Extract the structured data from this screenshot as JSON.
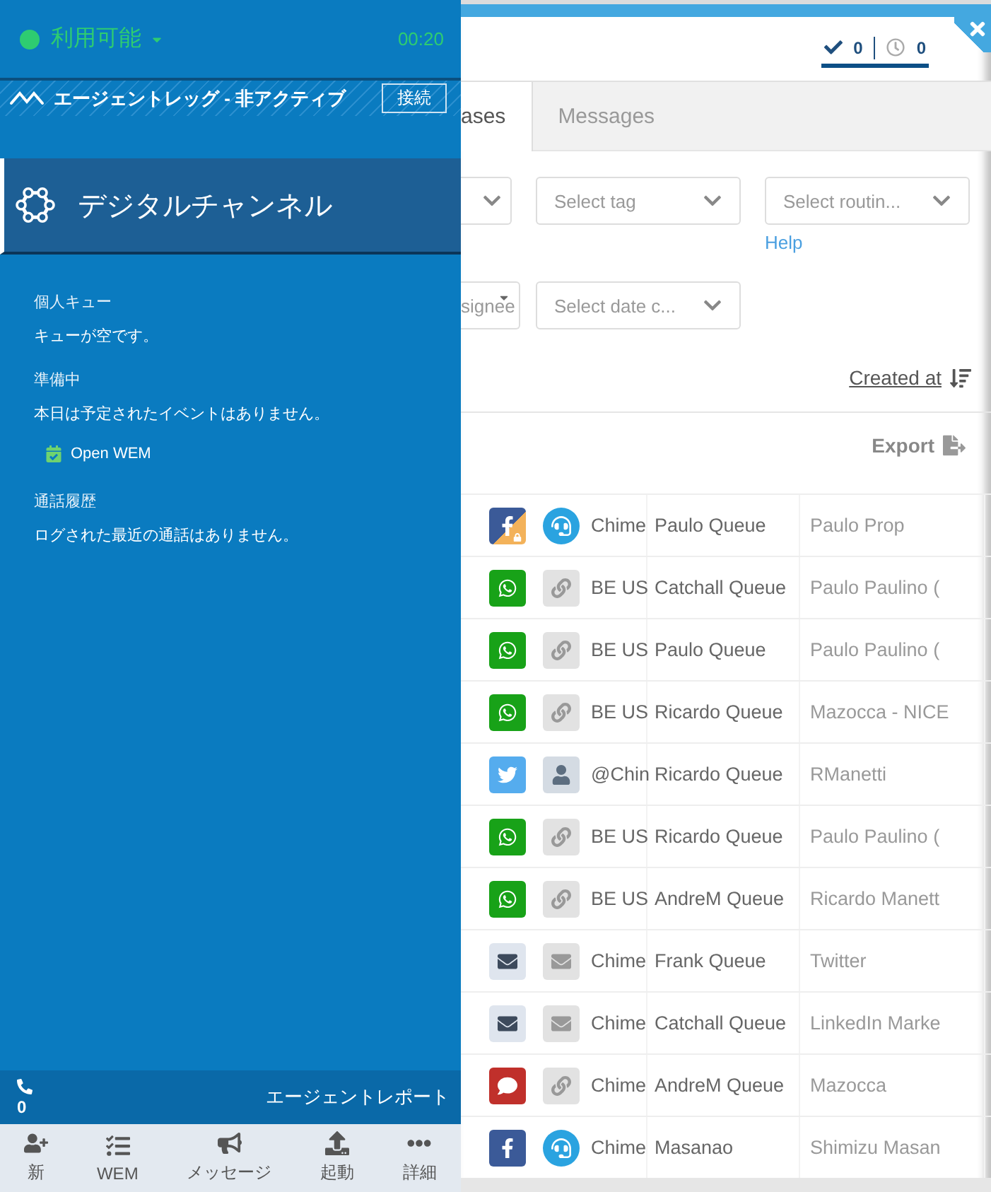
{
  "status": {
    "label": "利用可能",
    "time": "00:20"
  },
  "agent_leg": {
    "label": "エージェントレッグ - 非アクティブ",
    "button": "接続"
  },
  "channel": {
    "label": "デジタルチャンネル"
  },
  "sections": [
    {
      "heading": "個人キュー",
      "text": "キューが空です。"
    },
    {
      "heading": "準備中",
      "text": "本日は予定されたイベントはありません。",
      "link": "Open WEM"
    },
    {
      "heading": "通話履歴",
      "text": "ログされた最近の通話はありません。"
    }
  ],
  "call_bar": {
    "count": "0",
    "report": "エージェントレポート"
  },
  "nav": [
    {
      "kind": "new",
      "label": "新"
    },
    {
      "kind": "wem",
      "label": "WEM"
    },
    {
      "kind": "message",
      "label": "メッセージ"
    },
    {
      "kind": "launch",
      "label": "起動"
    },
    {
      "kind": "more",
      "label": "詳細"
    }
  ],
  "counters": [
    {
      "kind": "done",
      "value": "0"
    },
    {
      "kind": "pending",
      "value": "0"
    }
  ],
  "tabs": [
    {
      "label": "ases",
      "selected": true
    },
    {
      "label": "Messages",
      "selected": false
    }
  ],
  "filters": [
    [
      {
        "kind": "cut"
      },
      {
        "kind": "select",
        "placeholder": "Select tag"
      },
      {
        "kind": "select",
        "placeholder": "Select routin...",
        "help": "Help"
      }
    ],
    [
      {
        "kind": "cut",
        "placeholder": "signee"
      },
      {
        "kind": "select",
        "placeholder": "Select date c..."
      }
    ]
  ],
  "sort": {
    "label": "Created at"
  },
  "export": {
    "label": "Export"
  },
  "rows": [
    {
      "icons": [
        {
          "kind": "facebook-locked"
        },
        {
          "kind": "agent"
        }
      ],
      "source": "Chime",
      "queue": "Paulo Queue",
      "customer": "Paulo Prop"
    },
    {
      "icons": [
        {
          "kind": "whatsapp"
        },
        {
          "kind": "link"
        }
      ],
      "source": "BE US",
      "queue": "Catchall Queue",
      "customer": "Paulo Paulino ("
    },
    {
      "icons": [
        {
          "kind": "whatsapp"
        },
        {
          "kind": "link"
        }
      ],
      "source": "BE US",
      "queue": "Paulo Queue",
      "customer": "Paulo Paulino ("
    },
    {
      "icons": [
        {
          "kind": "whatsapp"
        },
        {
          "kind": "link"
        }
      ],
      "source": "BE US",
      "queue": "Ricardo Queue",
      "customer": "Mazocca - NICE"
    },
    {
      "icons": [
        {
          "kind": "twitter"
        },
        {
          "kind": "person"
        }
      ],
      "source": "@Chin",
      "queue": "Ricardo Queue",
      "customer": "RManetti"
    },
    {
      "icons": [
        {
          "kind": "whatsapp"
        },
        {
          "kind": "link"
        }
      ],
      "source": "BE US",
      "queue": "Ricardo Queue",
      "customer": "Paulo Paulino ("
    },
    {
      "icons": [
        {
          "kind": "whatsapp"
        },
        {
          "kind": "link"
        }
      ],
      "source": "BE US",
      "queue": "AndreM Queue",
      "customer": "Ricardo Manett"
    },
    {
      "icons": [
        {
          "kind": "email"
        },
        {
          "kind": "mail"
        }
      ],
      "source": "Chime",
      "queue": "Frank Queue",
      "customer": "Twitter"
    },
    {
      "icons": [
        {
          "kind": "email"
        },
        {
          "kind": "mail"
        }
      ],
      "source": "Chime",
      "queue": "Catchall Queue",
      "customer": "LinkedIn Marke"
    },
    {
      "icons": [
        {
          "kind": "chat"
        },
        {
          "kind": "link"
        }
      ],
      "source": "Chime",
      "queue": "AndreM Queue",
      "customer": "Mazocca"
    },
    {
      "icons": [
        {
          "kind": "facebook"
        },
        {
          "kind": "agent"
        }
      ],
      "source": "Chime",
      "queue": "Masanao",
      "customer": "Shimizu Masan"
    }
  ]
}
